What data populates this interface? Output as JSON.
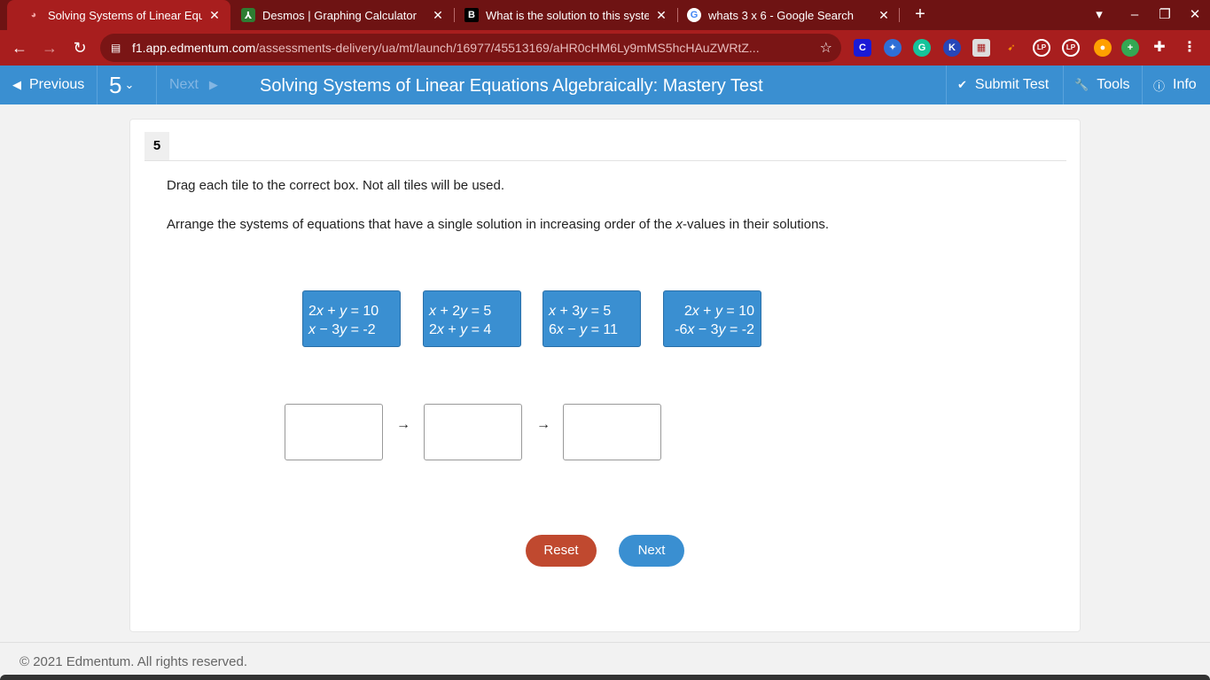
{
  "browser": {
    "tabs": [
      {
        "title": "Solving Systems of Linear Equatio",
        "favicon": "edmentum-icon",
        "active": true
      },
      {
        "title": "Desmos | Graphing Calculator",
        "favicon": "desmos-icon",
        "active": false
      },
      {
        "title": "What is the solution to this syste",
        "favicon": "brainly-icon",
        "active": false
      },
      {
        "title": "whats 3 x 6 - Google Search",
        "favicon": "google-icon",
        "active": false
      }
    ],
    "url_host": "f1.app.edmentum.com",
    "url_path": "/assessments-delivery/ua/mt/launch/16977/45513169/aHR0cHM6Ly9mMS5hcHAuZWRtZ...",
    "colors": {
      "frame": "#6e1313",
      "active_tab": "#a81e1e"
    }
  },
  "header": {
    "previous_label": "Previous",
    "question_number": "5",
    "next_label": "Next",
    "title": "Solving Systems of Linear Equations Algebraically: Mastery Test",
    "submit_label": "Submit Test",
    "tools_label": "Tools",
    "info_label": "Info",
    "color": "#3a8fd1"
  },
  "question": {
    "number": "5",
    "instruction1": "Drag each tile to the correct box. Not all tiles will be used.",
    "instruction2_pre": "Arrange the systems of equations that have a single solution in increasing order of the ",
    "instruction2_var": "x",
    "instruction2_post": "-values in their solutions.",
    "tiles": [
      {
        "line1": "2x + y = 10",
        "line2": "x − 3y = -2"
      },
      {
        "line1": "x + 2y = 5",
        "line2": "2x + y = 4"
      },
      {
        "line1": "x + 3y = 5",
        "line2": "6x − y = 11"
      },
      {
        "line1": "2x + y = 10",
        "line2": "-6x − 3y = -2"
      }
    ],
    "arrow": "→",
    "reset_label": "Reset",
    "next_label": "Next"
  },
  "footer": {
    "copyright": "© 2021 Edmentum. All rights reserved."
  }
}
